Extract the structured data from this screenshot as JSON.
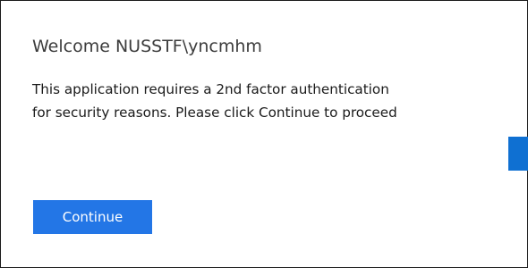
{
  "dialog": {
    "welcome_text": "Welcome NUSSTF\\yncmhm",
    "message_line1": "This application requires a 2nd factor authentication",
    "message_line2": "for security reasons. Please click Continue to proceed",
    "continue_label": "Continue"
  },
  "colors": {
    "primary_button": "#2376e6",
    "side_edge": "#0f70d2",
    "border": "#1a1a1a"
  }
}
